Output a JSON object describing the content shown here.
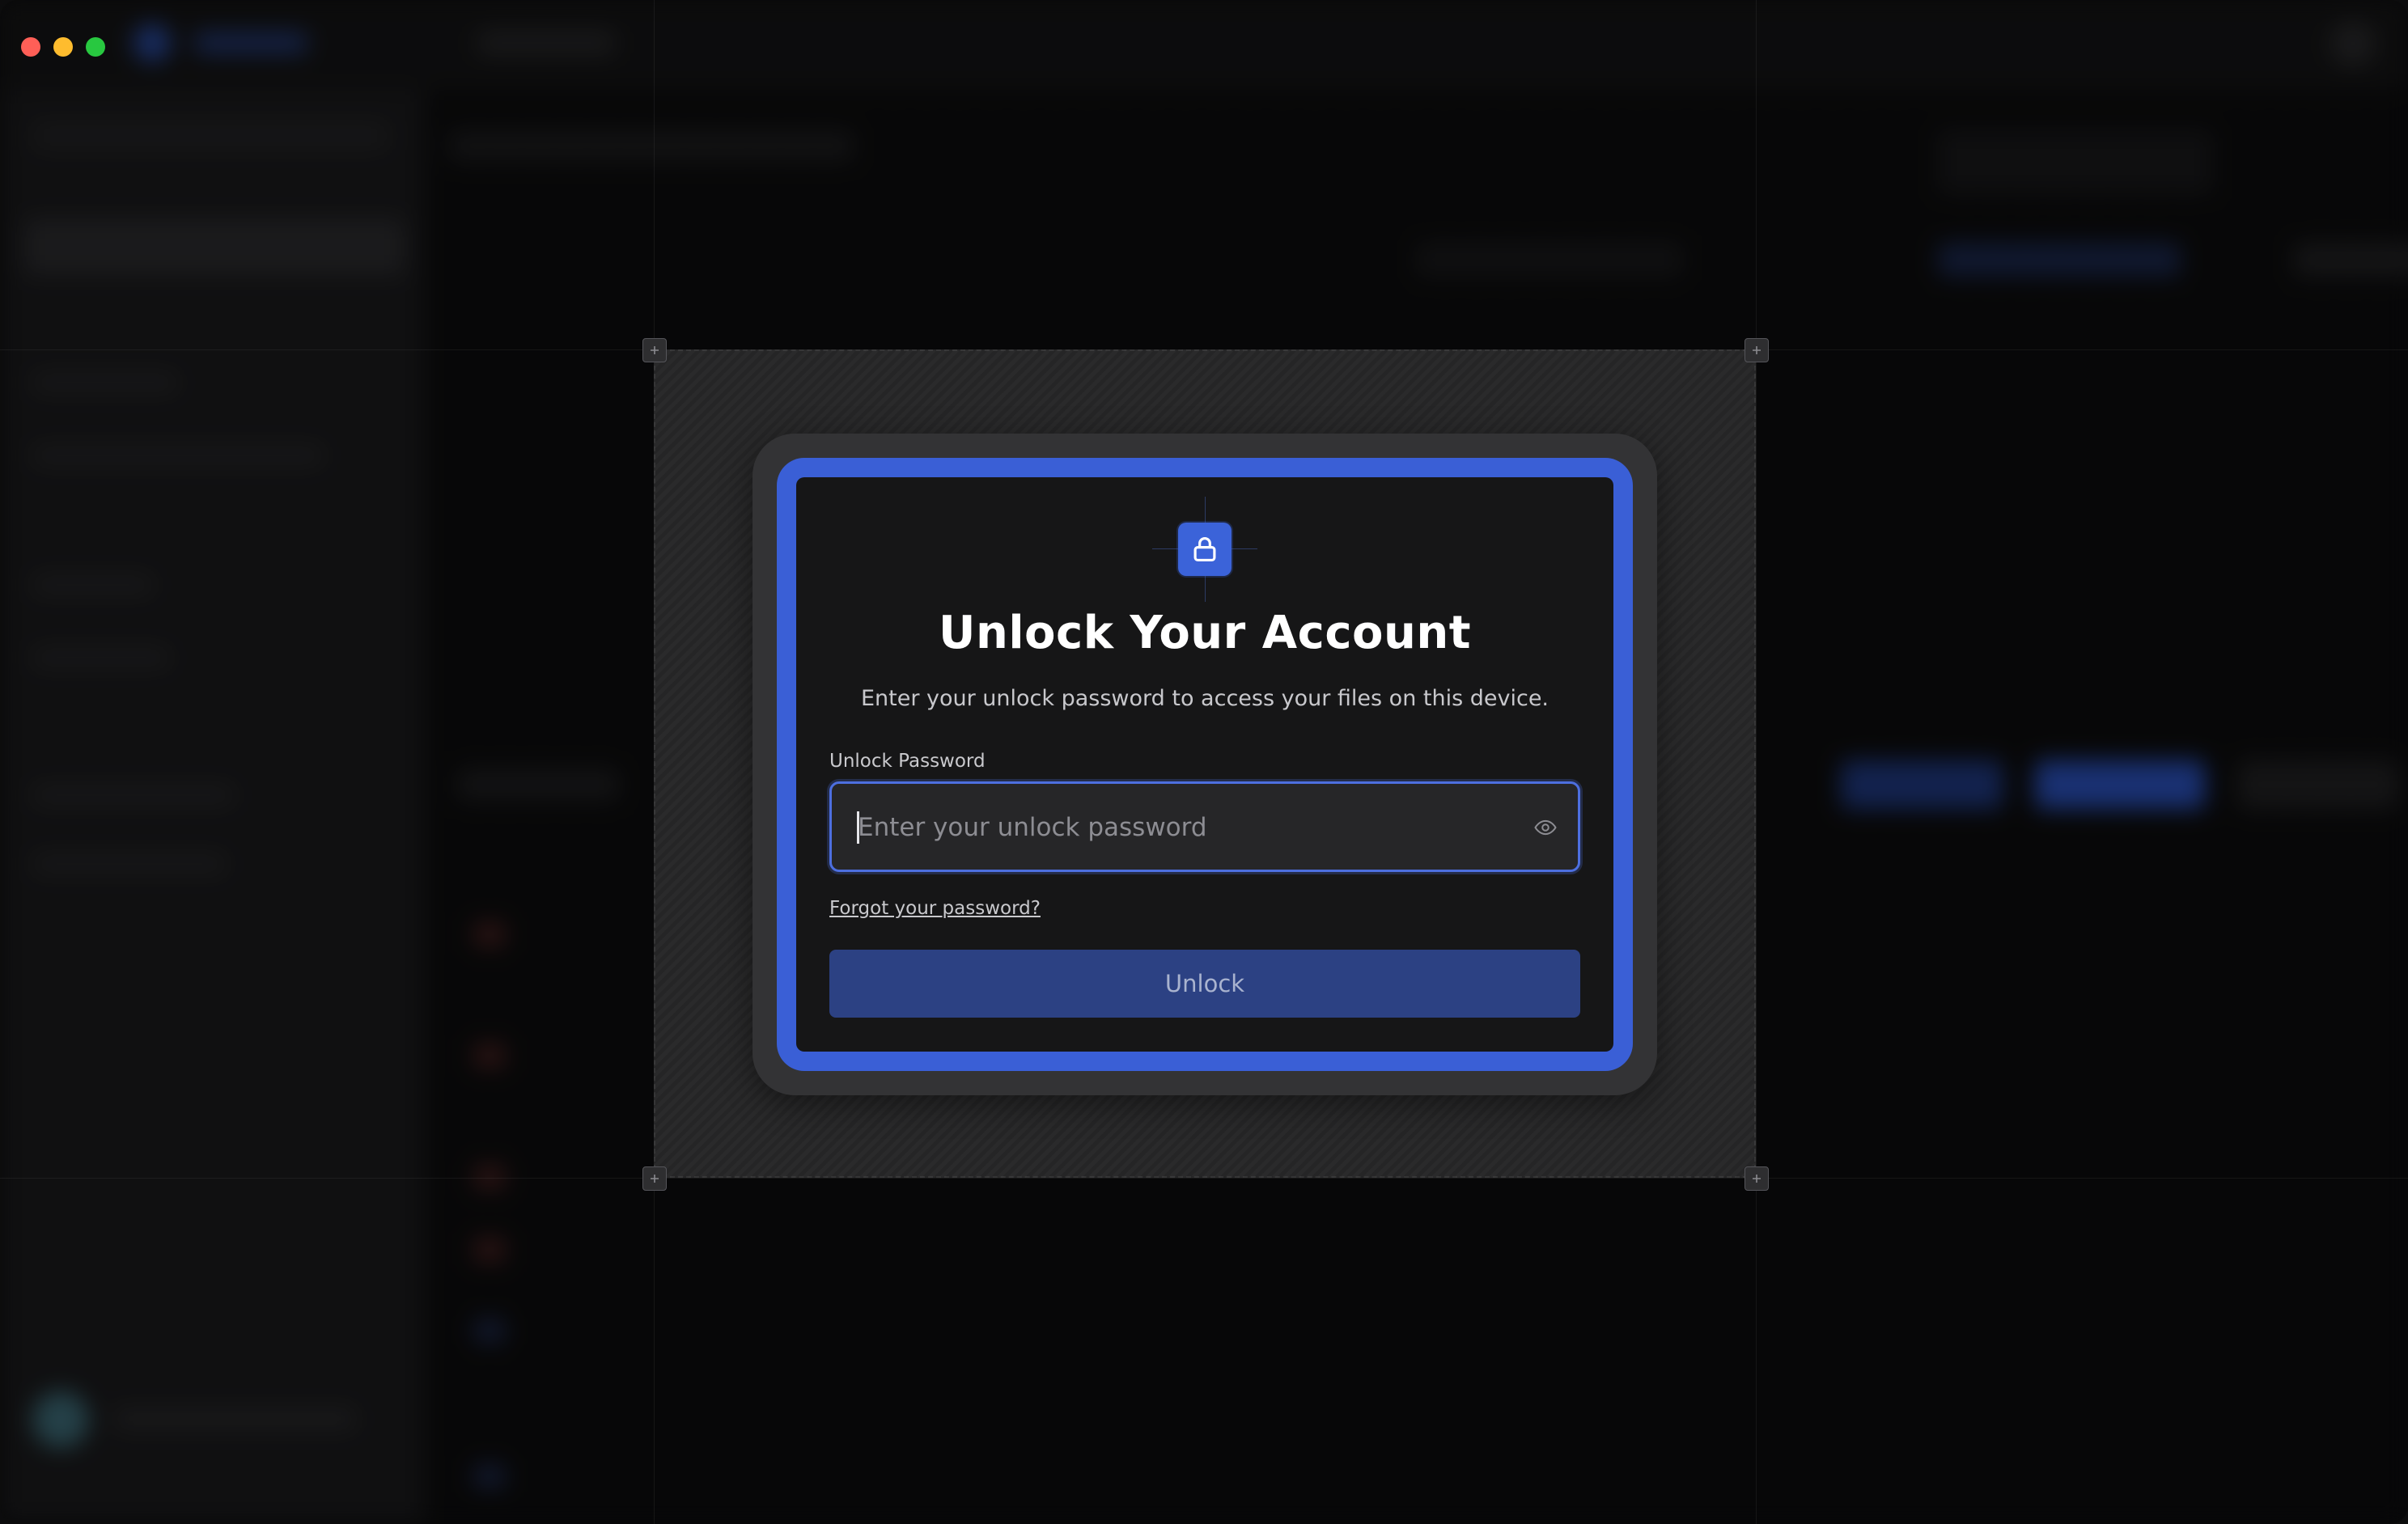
{
  "modal": {
    "title": "Unlock Your Account",
    "subtitle": "Enter your unlock password to access your files on this device.",
    "field_label": "Unlock Password",
    "password": {
      "value": "",
      "placeholder": "Enter your unlock password"
    },
    "forgot_link": "Forgot your password?",
    "unlock_button": "Unlock",
    "icons": {
      "header": "lock-icon",
      "toggle_visibility": "eye-icon"
    }
  },
  "colors": {
    "accent": "#3b63d9",
    "accent_ring": "#3a5fd6",
    "button_bg": "#2c4183",
    "traffic_close": "#ff5f57",
    "traffic_minimize": "#febc2e",
    "traffic_zoom": "#28c840"
  }
}
